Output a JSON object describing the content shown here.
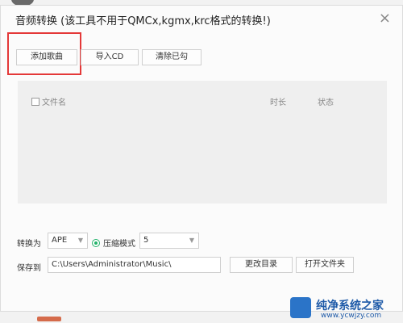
{
  "dialog": {
    "title": "音频转换 (该工具不用于QMCx,kgmx,krc格式的转换!)",
    "close_glyph": "×"
  },
  "toolbar": {
    "add_song": "添加歌曲",
    "import_cd": "导入CD",
    "clear_checked": "清除已勾"
  },
  "list": {
    "columns": {
      "filename": "文件名",
      "duration": "时长",
      "status": "状态"
    }
  },
  "convert": {
    "label": "转换为",
    "format": "APE",
    "compression_label": "压缩模式",
    "compression_level": "5"
  },
  "save": {
    "label": "保存到",
    "path": "C:\\Users\\Administrator\\Music\\",
    "change_dir": "更改目录",
    "open_folder": "打开文件夹"
  },
  "watermark": {
    "name": "纯净系统之家",
    "url": "www.ycwjzy.com"
  },
  "colors": {
    "accent_green": "#24b36b",
    "highlight_red": "#e43838"
  }
}
